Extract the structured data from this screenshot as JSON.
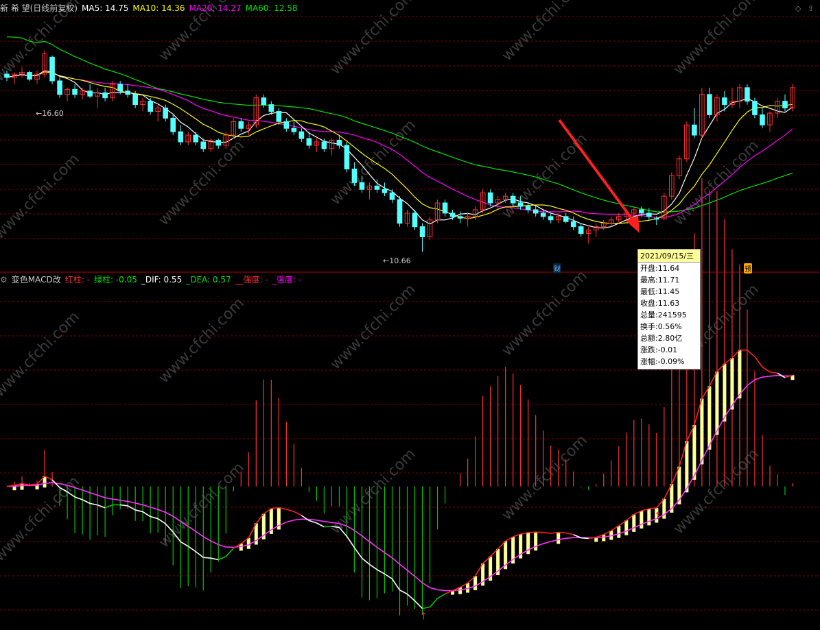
{
  "header": {
    "title": "新 希 望(日线前复权)",
    "ma5": "MA5: 14.75",
    "ma10": "MA10: 14.36",
    "ma20": "MA20: 14.27",
    "ma60": "MA60: 12.58"
  },
  "macd_header": {
    "name": "变色MACD改",
    "red_col": "红柱: -",
    "green_col": "绿柱: -0.05",
    "dif": "_DIF: 0.55",
    "dea": "_DEA: 0.57",
    "strength1": "__强度: -",
    "strength2": "_强度: -"
  },
  "price_labels": {
    "high": "16.60",
    "low": "10.66"
  },
  "markers": {
    "cai": "财",
    "yu": "预"
  },
  "tooltip": {
    "date": "2021/09/15/三",
    "rows": [
      "开盘:11.64",
      "最高:11.71",
      "最低:11.45",
      "收盘:11.63",
      "总量:241595",
      "换手:0.56%",
      "总额:2.80亿",
      "涨跌:-0.01",
      "涨幅:-0.09%"
    ]
  },
  "watermark": "www.cfchi.com",
  "colors": {
    "up": "#ff3232",
    "down": "#54ffff",
    "ma5": "#ffffff",
    "ma10": "#ffff00",
    "ma20": "#ff00ff",
    "ma60": "#00e600",
    "grid": "#800000",
    "arrow": "#ff2020"
  },
  "chart_data": {
    "type": "candlestick",
    "price_ylim": [
      10.2,
      17.6
    ],
    "candles": [
      [
        15.9,
        16.0,
        15.7,
        15.8
      ],
      [
        15.8,
        15.95,
        15.6,
        15.9
      ],
      [
        15.9,
        16.1,
        15.8,
        15.95
      ],
      [
        15.95,
        16.0,
        15.7,
        15.75
      ],
      [
        15.75,
        16.0,
        15.6,
        15.9
      ],
      [
        15.9,
        16.6,
        15.8,
        16.5
      ],
      [
        16.4,
        16.45,
        15.6,
        15.7
      ],
      [
        15.7,
        15.8,
        15.2,
        15.3
      ],
      [
        15.3,
        15.5,
        15.1,
        15.45
      ],
      [
        15.45,
        15.6,
        15.2,
        15.3
      ],
      [
        15.3,
        15.5,
        15.15,
        15.4
      ],
      [
        15.4,
        15.6,
        15.2,
        15.25
      ],
      [
        15.25,
        15.5,
        14.9,
        15.35
      ],
      [
        15.35,
        15.5,
        15.1,
        15.2
      ],
      [
        15.2,
        15.7,
        15.1,
        15.6
      ],
      [
        15.6,
        15.7,
        15.3,
        15.4
      ],
      [
        15.4,
        15.6,
        15.2,
        15.3
      ],
      [
        15.3,
        15.4,
        14.9,
        15.0
      ],
      [
        15.0,
        15.2,
        14.8,
        15.1
      ],
      [
        15.1,
        15.2,
        14.7,
        14.8
      ],
      [
        14.8,
        15.0,
        14.5,
        14.9
      ],
      [
        14.9,
        15.0,
        14.5,
        14.6
      ],
      [
        14.6,
        14.7,
        14.1,
        14.2
      ],
      [
        14.2,
        14.4,
        13.8,
        13.9
      ],
      [
        13.9,
        14.2,
        13.8,
        14.1
      ],
      [
        14.1,
        14.2,
        13.8,
        13.9
      ],
      [
        13.9,
        14.0,
        13.6,
        13.7
      ],
      [
        13.7,
        14.0,
        13.6,
        13.95
      ],
      [
        13.95,
        14.0,
        13.7,
        13.8
      ],
      [
        13.8,
        14.2,
        13.7,
        14.1
      ],
      [
        14.1,
        14.6,
        14.0,
        14.5
      ],
      [
        14.5,
        14.6,
        14.2,
        14.3
      ],
      [
        14.3,
        14.5,
        14.1,
        14.4
      ],
      [
        14.4,
        15.3,
        14.3,
        15.2
      ],
      [
        15.2,
        15.3,
        14.9,
        15.0
      ],
      [
        15.0,
        15.1,
        14.7,
        14.8
      ],
      [
        14.8,
        14.9,
        14.4,
        14.5
      ],
      [
        14.5,
        14.6,
        14.2,
        14.3
      ],
      [
        14.3,
        14.5,
        14.1,
        14.2
      ],
      [
        14.2,
        14.3,
        13.9,
        14.0
      ],
      [
        14.0,
        14.2,
        13.7,
        13.8
      ],
      [
        13.8,
        14.0,
        13.6,
        13.9
      ],
      [
        13.9,
        14.0,
        13.6,
        13.7
      ],
      [
        13.7,
        14.0,
        13.5,
        13.95
      ],
      [
        13.95,
        14.1,
        13.7,
        13.8
      ],
      [
        13.8,
        13.9,
        13.0,
        13.1
      ],
      [
        13.1,
        13.3,
        12.6,
        12.7
      ],
      [
        12.7,
        12.9,
        12.4,
        12.5
      ],
      [
        12.5,
        12.7,
        12.2,
        12.6
      ],
      [
        12.6,
        12.8,
        12.4,
        12.5
      ],
      [
        12.5,
        12.7,
        12.3,
        12.4
      ],
      [
        12.4,
        12.5,
        12.1,
        12.2
      ],
      [
        12.2,
        12.3,
        11.4,
        11.5
      ],
      [
        11.5,
        11.9,
        11.4,
        11.8
      ],
      [
        11.8,
        11.9,
        11.3,
        11.4
      ],
      [
        11.4,
        11.5,
        10.66,
        11.1
      ],
      [
        11.1,
        11.7,
        11.0,
        11.6
      ],
      [
        11.6,
        12.2,
        11.5,
        12.1
      ],
      [
        12.1,
        12.2,
        11.7,
        11.8
      ],
      [
        11.8,
        11.9,
        11.6,
        11.7
      ],
      [
        11.7,
        11.85,
        11.5,
        11.65
      ],
      [
        11.65,
        11.8,
        11.4,
        11.7
      ],
      [
        11.7,
        12.0,
        11.6,
        11.9
      ],
      [
        11.9,
        12.5,
        11.8,
        12.4
      ],
      [
        12.4,
        12.5,
        12.0,
        12.1
      ],
      [
        12.1,
        12.3,
        11.9,
        12.2
      ],
      [
        12.2,
        12.4,
        12.1,
        12.3
      ],
      [
        12.3,
        12.4,
        12.0,
        12.1
      ],
      [
        12.1,
        12.3,
        11.9,
        12.0
      ],
      [
        12.0,
        12.1,
        11.8,
        11.9
      ],
      [
        11.9,
        12.0,
        11.7,
        11.8
      ],
      [
        11.8,
        11.9,
        11.6,
        11.7
      ],
      [
        11.7,
        11.8,
        11.5,
        11.6
      ],
      [
        11.6,
        11.8,
        11.5,
        11.7
      ],
      [
        11.7,
        11.8,
        11.5,
        11.55
      ],
      [
        11.55,
        11.7,
        11.3,
        11.4
      ],
      [
        11.4,
        11.5,
        11.1,
        11.2
      ],
      [
        11.2,
        11.4,
        10.9,
        11.3
      ],
      [
        11.3,
        11.5,
        11.1,
        11.4
      ],
      [
        11.4,
        11.6,
        11.3,
        11.5
      ],
      [
        11.5,
        11.7,
        11.4,
        11.6
      ],
      [
        11.6,
        11.8,
        11.5,
        11.7
      ],
      [
        11.7,
        11.9,
        11.6,
        11.8
      ],
      [
        11.8,
        12.0,
        11.7,
        11.9
      ],
      [
        11.9,
        12.0,
        11.7,
        11.8
      ],
      [
        11.8,
        11.95,
        11.6,
        11.7
      ],
      [
        11.64,
        11.71,
        11.45,
        11.63
      ],
      [
        11.63,
        12.4,
        11.6,
        12.3
      ],
      [
        12.3,
        13.0,
        12.2,
        12.9
      ],
      [
        12.9,
        13.5,
        12.8,
        13.4
      ],
      [
        13.4,
        14.5,
        13.3,
        14.4
      ],
      [
        14.4,
        14.9,
        14.0,
        14.1
      ],
      [
        14.1,
        15.5,
        14.0,
        15.3
      ],
      [
        15.3,
        15.5,
        14.6,
        14.7
      ],
      [
        14.7,
        15.3,
        14.5,
        15.2
      ],
      [
        15.2,
        15.4,
        14.8,
        15.0
      ],
      [
        15.0,
        15.5,
        14.9,
        15.1
      ],
      [
        15.1,
        15.6,
        14.9,
        15.5
      ],
      [
        15.5,
        15.6,
        15.0,
        15.1
      ],
      [
        15.1,
        15.2,
        14.6,
        14.7
      ],
      [
        14.7,
        14.9,
        14.3,
        14.4
      ],
      [
        14.4,
        14.8,
        14.2,
        14.75
      ],
      [
        14.75,
        15.2,
        14.6,
        15.1
      ],
      [
        15.1,
        15.3,
        14.8,
        14.9
      ],
      [
        14.9,
        15.6,
        14.8,
        15.5
      ]
    ],
    "macd_ylim": [
      -0.9,
      1.3
    ],
    "signal_markers": [
      {
        "index": 55,
        "type": "buy"
      },
      {
        "index": 86,
        "type": "buy"
      }
    ]
  }
}
